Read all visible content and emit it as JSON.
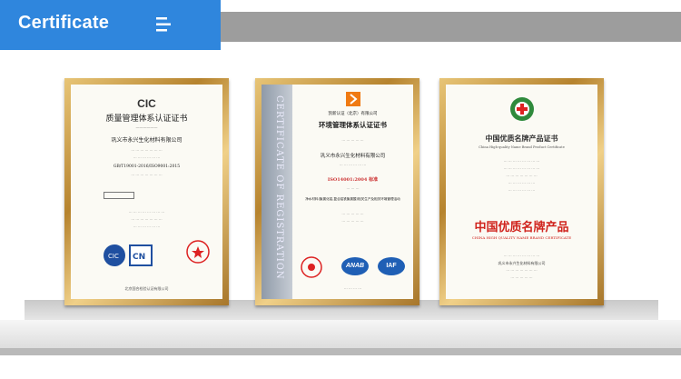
{
  "header": {
    "title": "Certificate",
    "accent_color": "#2f86dd",
    "bar_color": "#9d9d9d",
    "menu_icon": "menu-icon"
  },
  "certificates": [
    {
      "logo": "CIC",
      "title": "质量管理体系认证证书",
      "company": "巩义市永兴生化材料有限公司",
      "standard": "GB/T19001-2016/ISO9001:2015",
      "footer": "北京国合检验认证有限公司"
    },
    {
      "issuer": "凯新认证（北京）有限公司",
      "title": "环境管理体系认证证书",
      "company": "巩义市永兴生化材料有限公司",
      "standard": "ISO14001:2004 标准",
      "scope": "净水材料(聚氯化铝,复合铝铁聚氯酸)相关生产及相关环境管理活动",
      "side_text": "CERTIFICATE OF REGISTRATION",
      "badges": [
        "ANAB",
        "IAF"
      ]
    },
    {
      "title": "中国优质名牌产品证书",
      "subtitle": "China High-quality Name Brand Product Certificate",
      "big_text": "中国优质名牌产品",
      "big_text_en": "CHINA HIGH QUALITY NAME BRAND CERTIFICATE",
      "company": "巩义市永兴生化材料有限公司"
    }
  ]
}
